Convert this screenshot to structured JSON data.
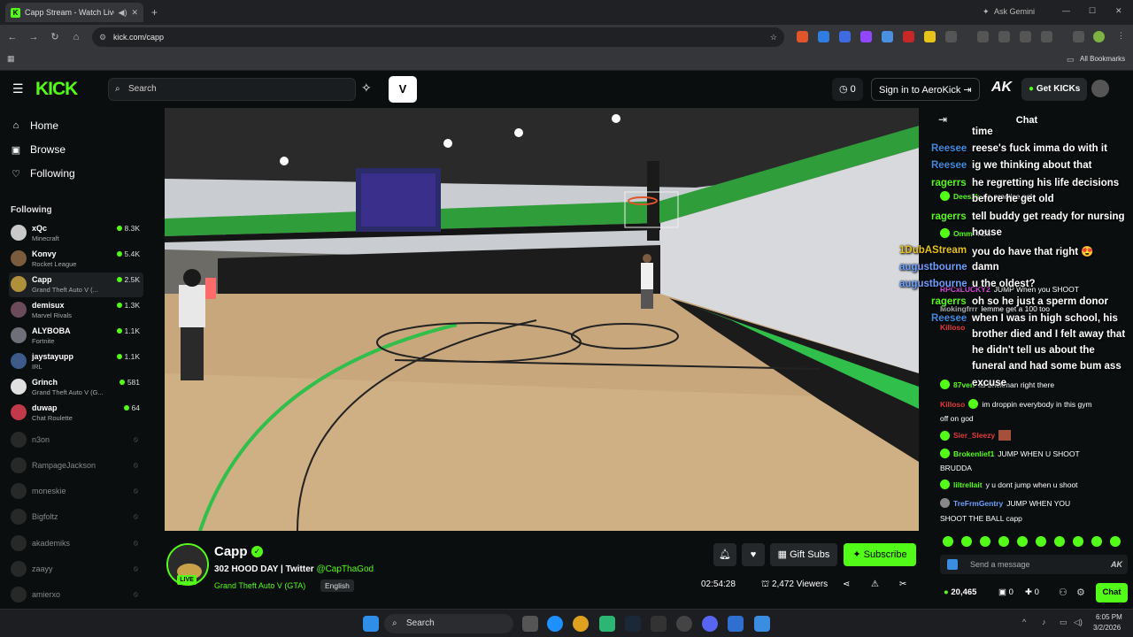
{
  "browser": {
    "tab_title": "Capp Stream - Watch Live ...",
    "new_tab": "+",
    "gemini": "Ask Gemini",
    "url": "kick.com/capp",
    "bookmarks_label": "All Bookmarks"
  },
  "header": {
    "search_placeholder": "Search",
    "viewers_count": "0",
    "signin_label": "Sign in to AeroKick",
    "ak_label": "AK",
    "get_kicks_label": "Get KICKs",
    "logo_text": "KICK"
  },
  "sidebar": {
    "nav": [
      {
        "label": "Home",
        "icon": "home-icon"
      },
      {
        "label": "Browse",
        "icon": "browse-icon"
      },
      {
        "label": "Following",
        "icon": "heart-icon"
      }
    ],
    "following_title": "Following",
    "live_channels": [
      {
        "name": "xQc",
        "category": "Minecraft",
        "viewers": "8.3K",
        "color": "#c9c9c9"
      },
      {
        "name": "Konvy",
        "category": "Rocket League",
        "viewers": "5.4K",
        "color": "#7a5b3e"
      },
      {
        "name": "Capp",
        "category": "Grand Theft Auto V (...",
        "viewers": "2.5K",
        "color": "#b0903a"
      },
      {
        "name": "demisux",
        "category": "Marvel Rivals",
        "viewers": "1.3K",
        "color": "#6b4a5a"
      },
      {
        "name": "ALYBOBA",
        "category": "Fortnite",
        "viewers": "1.1K",
        "color": "#6f6f7a"
      },
      {
        "name": "jaystayupp",
        "category": "IRL",
        "viewers": "1.1K",
        "color": "#3c5a8a"
      },
      {
        "name": "Grinch",
        "category": "Grand Theft Auto V (G...",
        "viewers": "581",
        "color": "#e0e0e0"
      },
      {
        "name": "duwap",
        "category": "Chat Roulette",
        "viewers": "64",
        "color": "#c23a4a"
      }
    ],
    "offline_channels": [
      "n3on",
      "RampageJackson",
      "moneskie",
      "Bigfoltz",
      "akademiks",
      "zaayy",
      "amierxo"
    ]
  },
  "stream": {
    "name": "Capp",
    "title": "302 HOOD DAY | Twitter",
    "twitter": "@CapThaGod",
    "category": "Grand Theft Auto V (GTA)",
    "language": "English",
    "live_badge": "LIVE",
    "uptime": "02:54:28",
    "viewers": "2,472 Viewers",
    "gift_subs": "Gift Subs",
    "subscribe": "Subscribe"
  },
  "chat": {
    "title": "Chat",
    "overlay_lines": [
      {
        "user": "",
        "text": "time"
      },
      {
        "user": "Reesee",
        "text": "reese's fuck imma do with it"
      },
      {
        "user": "Reesee",
        "text": "ig we thinking about that"
      },
      {
        "user": "ragerrs",
        "text": "he regretting his life decisions"
      },
      {
        "user": "",
        "text": "before he get old"
      },
      {
        "user": "ragerrs",
        "text": "tell buddy get ready for nursing"
      },
      {
        "user": "",
        "text": "house"
      },
      {
        "user": "1DubAStream",
        "text": "you do have that right 😍"
      },
      {
        "user": "augustbourne",
        "text": "damn"
      },
      {
        "user": "augustbourne",
        "text": "u the oldest?"
      },
      {
        "user": "ragerrs",
        "text": "oh so he just a sperm donor"
      },
      {
        "user": "Reesee",
        "text": "when I was in high school, his"
      },
      {
        "user": "",
        "text": "brother died and I felt away that"
      },
      {
        "user": "",
        "text": "he didn't tell us about the"
      },
      {
        "user": "",
        "text": "funeral and had some bum ass"
      },
      {
        "user": "",
        "text": "excuse"
      }
    ],
    "messages": [
      {
        "user": "Dees2k",
        "text": "no practice ngl",
        "color": "#53fc18"
      },
      {
        "user": "Omm",
        "text": "YES",
        "color": "#53fc18"
      },
      {
        "user": "RPCxLUCKY2",
        "text": "JUMP When you SHOOT",
        "color": "#d64ad6"
      },
      {
        "user": "Mokingfrrr",
        "text": "lemme get a 100 too",
        "color": "#aaaaaa"
      },
      {
        "user": "Killoso",
        "text": "",
        "color": "#e33a3a"
      },
      {
        "user": "87ven",
        "text": "its brickman right there",
        "color": "#53fc18"
      },
      {
        "user": "Killoso",
        "text": "im droppin everybody in this gym",
        "color": "#e33a3a"
      },
      {
        "user": "",
        "text": "off on god",
        "color": "#ffffff"
      },
      {
        "user": "Sier_Sleezy",
        "text": "",
        "color": "#e33a3a"
      },
      {
        "user": "Brokenlief1",
        "text": "JUMP WHEN U SHOOT",
        "color": "#53fc18"
      },
      {
        "user": "",
        "text": "BRUDDA",
        "color": "#ffffff"
      },
      {
        "user": "liltrellait",
        "text": "y u dont jump when u shoot",
        "color": "#53fc18"
      },
      {
        "user": "TreFrmGentry",
        "text": "JUMP WHEN YOU",
        "color": "#6aa0ff"
      },
      {
        "user": "",
        "text": "SHOOT THE BALL  capp",
        "color": "#ffffff"
      }
    ],
    "input_placeholder": "Send a message",
    "kicks_count": "20,465",
    "zero_a": "0",
    "zero_b": "0",
    "chat_button": "Chat"
  },
  "taskbar": {
    "search": "Search",
    "time": "6:05 PM",
    "date": "3/2/2026"
  }
}
